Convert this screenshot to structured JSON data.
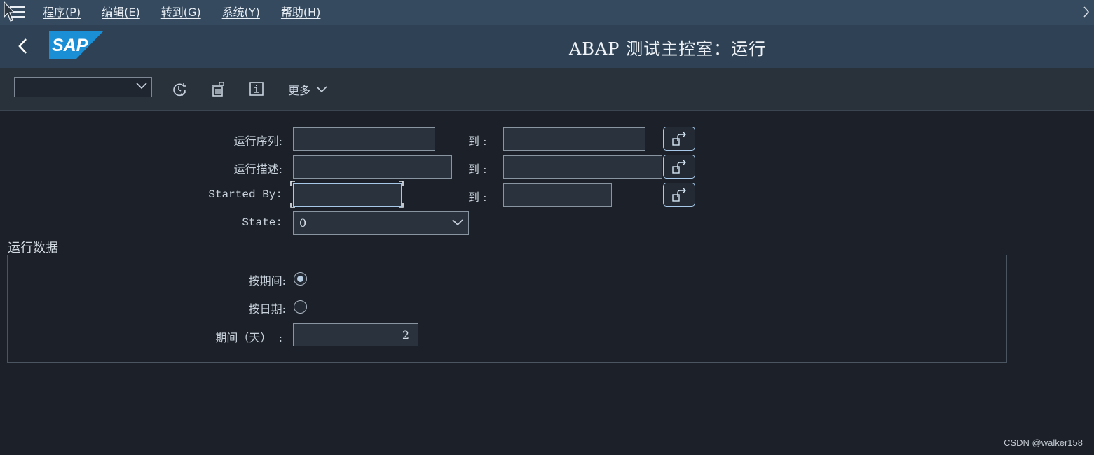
{
  "menubar": {
    "items": [
      {
        "label": "程序(P)"
      },
      {
        "label": "编辑(E)"
      },
      {
        "label": "转到(G)"
      },
      {
        "label": "系统(Y)"
      },
      {
        "label": "帮助(H)"
      }
    ],
    "icons": [
      "hamburger-menu-icon",
      "chevron-right-icon"
    ]
  },
  "header": {
    "title": "ABAP 测试主控室：运行",
    "logo_text": "SAP",
    "icons": [
      "back-chevron-icon",
      "sap-logo"
    ]
  },
  "toolbar": {
    "variant_select_value": "",
    "more_label": "更多",
    "icons": [
      "history-clock-icon",
      "delete-variant-icon",
      "info-icon",
      "chevron-down-icon"
    ]
  },
  "form": {
    "run_series": {
      "label": "运行序列:",
      "from": "",
      "to_label": "到 :",
      "to": ""
    },
    "run_desc": {
      "label": "运行描述:",
      "from": "",
      "to_label": "到 :",
      "to": ""
    },
    "started_by": {
      "label": "Started By:",
      "from": "",
      "to_label": "到 :",
      "to": ""
    },
    "state": {
      "label": "State:",
      "value": "0"
    }
  },
  "run_data": {
    "title": "运行数据",
    "by_period": {
      "label": "按期间:",
      "checked": true
    },
    "by_date": {
      "label": "按日期:",
      "checked": false
    },
    "period_days": {
      "label": "期间（天）  :",
      "value": "2"
    }
  },
  "watermark": "CSDN @walker158",
  "colors": {
    "background": "#1c2129",
    "menubar": "#354a5f",
    "titlebar": "#2f4255",
    "toolbar": "#29313b",
    "accent": "#a7c8e8",
    "sap_blue": "#1b8fd6"
  }
}
